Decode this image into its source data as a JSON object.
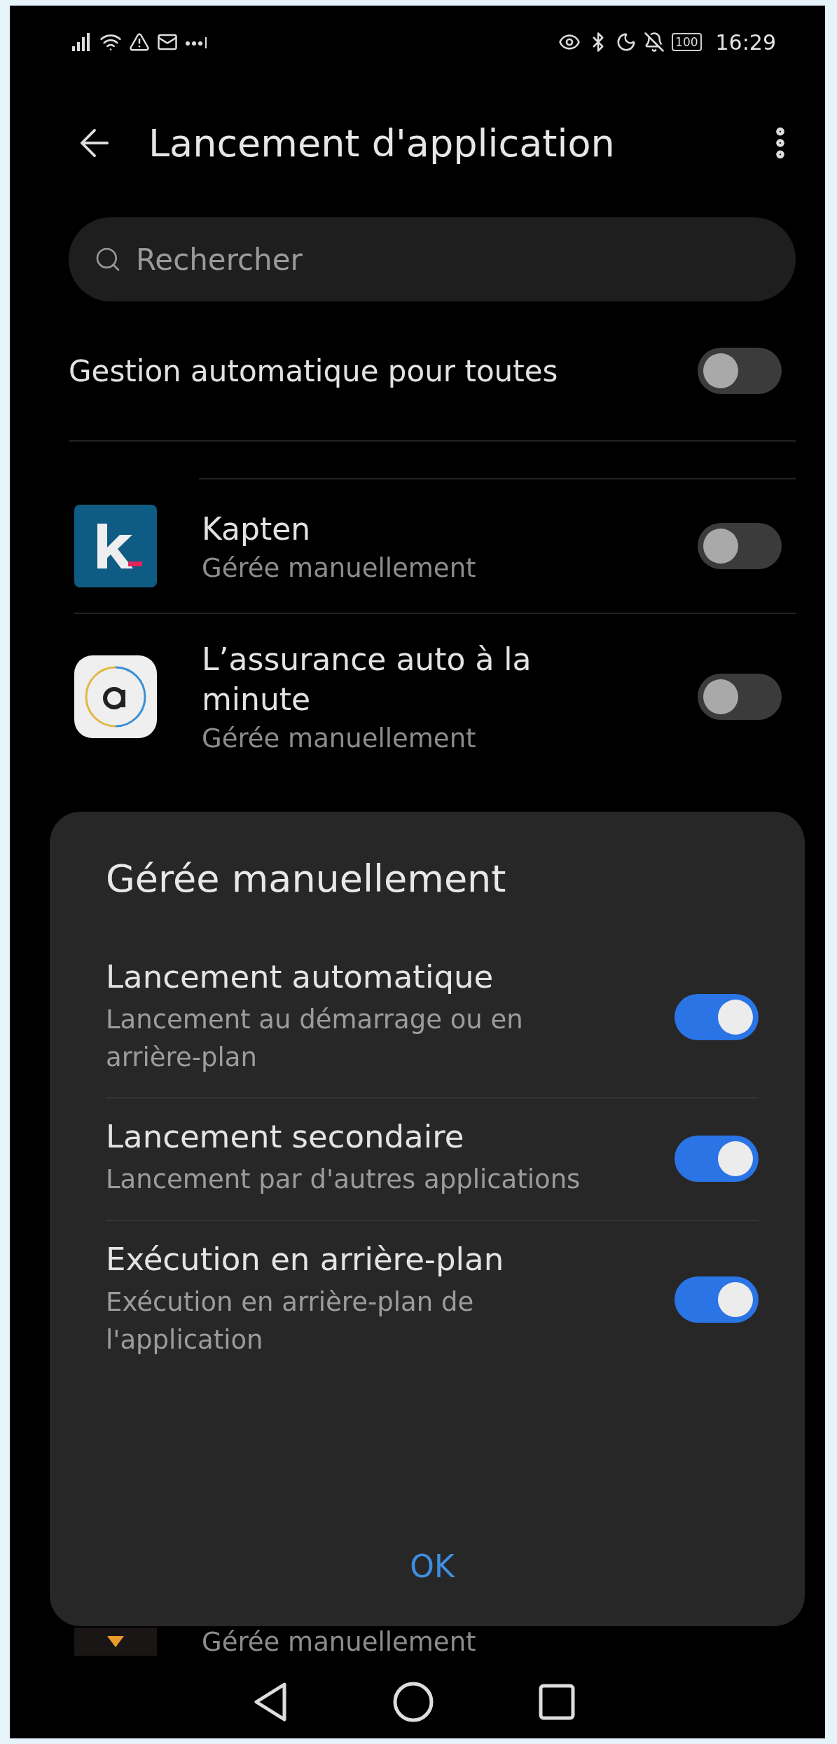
{
  "status_bar": {
    "battery": "100",
    "time": "16:29"
  },
  "header": {
    "title": "Lancement d'application"
  },
  "search": {
    "placeholder": "Rechercher"
  },
  "auto_manage_all": {
    "label": "Gestion automatique pour toutes",
    "on": false
  },
  "apps": [
    {
      "kind": "letter",
      "name": "Kapten",
      "status": "Gérée manuellement",
      "on": false
    },
    {
      "kind": "ring",
      "name": "L’assurance auto à la minute",
      "status": "Gérée manuellement",
      "on": false
    }
  ],
  "hidden_app": {
    "status": "Gérée manuellement"
  },
  "dialog": {
    "title": "Gérée manuellement",
    "options": [
      {
        "title": "Lancement automatique",
        "description": "Lancement au démarrage ou en arrière-plan",
        "on": true
      },
      {
        "title": "Lancement secondaire",
        "description": "Lancement par d'autres applications",
        "on": true
      },
      {
        "title": "Exécution en arrière-plan",
        "description": "Exécution en arrière-plan de l'application",
        "on": true
      }
    ],
    "button": "OK"
  }
}
